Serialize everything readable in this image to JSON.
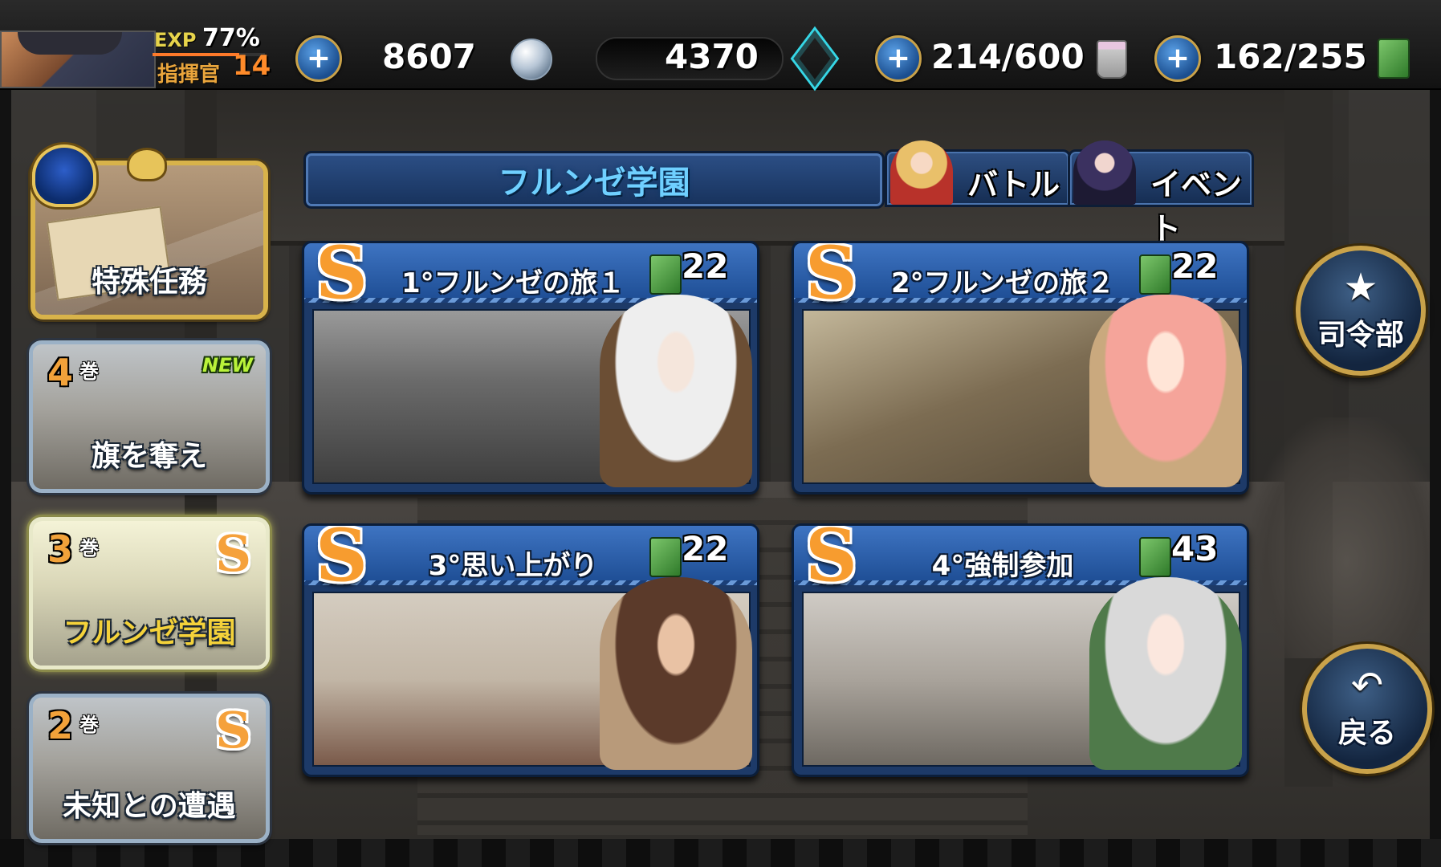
{
  "player": {
    "exp_label": "EXP",
    "exp_percent": "77%",
    "exp_fraction": 0.77,
    "rank_label": "指揮官",
    "level": "14"
  },
  "resources": {
    "silver": "8607",
    "cubes": "4370",
    "paint": "214/600",
    "fuel": "162/255",
    "add_symbol": "+"
  },
  "header": {
    "chapter_title": "フルンゼ学園",
    "tabs": [
      {
        "label": "バトル"
      },
      {
        "label": "イベント"
      }
    ]
  },
  "sidebar": {
    "special": {
      "label": "特殊任務"
    },
    "volumes": [
      {
        "vol": "4",
        "vol_suffix": "巻",
        "badge": "NEW",
        "label": "旗を奪え"
      },
      {
        "vol": "3",
        "vol_suffix": "巻",
        "grade": "S",
        "label": "フルンゼ学園"
      },
      {
        "vol": "2",
        "vol_suffix": "巻",
        "grade": "S",
        "label": "未知との遭遇"
      }
    ]
  },
  "missions": [
    {
      "grade": "S",
      "title": "1°フルンゼの旅１",
      "cost": "22"
    },
    {
      "grade": "S",
      "title": "2°フルンゼの旅２",
      "cost": "22"
    },
    {
      "grade": "S",
      "title": "3°思い上がり",
      "cost": "22"
    },
    {
      "grade": "S",
      "title": "4°強制参加",
      "cost": "43"
    }
  ],
  "buttons": {
    "hq": "司令部",
    "back": "戻る"
  },
  "colors": {
    "accent_gold": "#c9a24a",
    "panel_blue": "#1f4f96",
    "grade_orange": "#f79c2f",
    "title_cyan": "#6fd0ff"
  }
}
